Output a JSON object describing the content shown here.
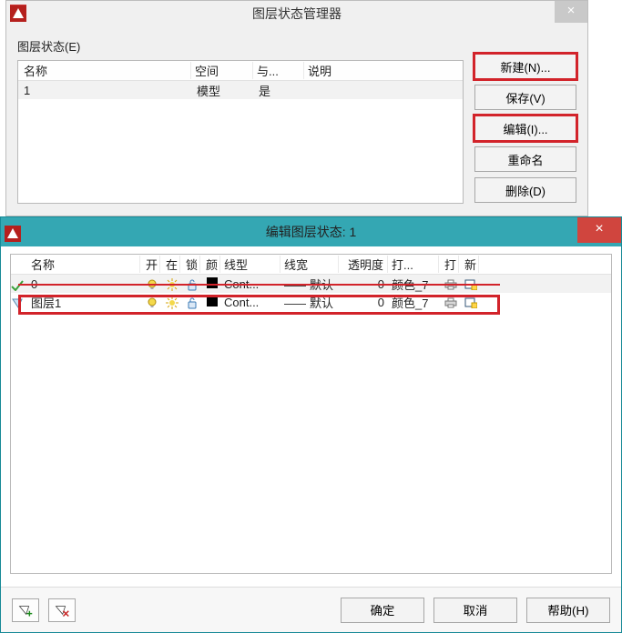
{
  "dlg1": {
    "title": "图层状态管理器",
    "label": "图层状态(E)",
    "columns": {
      "name": "名称",
      "space": "空间",
      "same": "与...",
      "desc": "说明"
    },
    "rows": [
      {
        "name": "1",
        "space": "模型",
        "same": "是",
        "desc": ""
      }
    ],
    "buttons": {
      "new": "新建(N)...",
      "save": "保存(V)",
      "edit": "编辑(I)...",
      "rename": "重命名",
      "delete": "删除(D)"
    }
  },
  "dlg2": {
    "title": "编辑图层状态: 1",
    "columns": {
      "name": "名称",
      "on": "开",
      "freeze": "在",
      "lock": "锁",
      "color": "颜",
      "ltype": "线型",
      "lw": "线宽",
      "trans": "透明度",
      "pstyle": "打...",
      "plot": "打",
      "newvp": "新"
    },
    "rows": [
      {
        "name": "0",
        "ltype": "Cont...",
        "lw": "默认",
        "trans": "0",
        "pstyle": "颜色_7"
      },
      {
        "name": "图层1",
        "ltype": "Cont...",
        "lw": "默认",
        "trans": "0",
        "pstyle": "颜色_7"
      }
    ],
    "footer": {
      "ok": "确定",
      "cancel": "取消",
      "help": "帮助(H)"
    }
  }
}
